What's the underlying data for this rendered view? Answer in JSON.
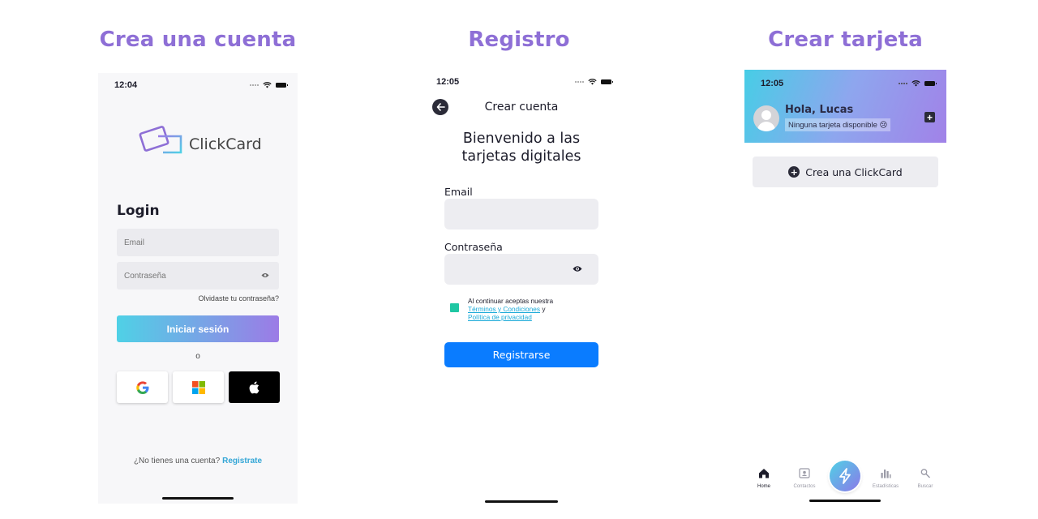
{
  "sections": [
    {
      "title": "Crea una cuenta"
    },
    {
      "title": "Registro"
    },
    {
      "title": "Crear tarjeta"
    }
  ],
  "login_screen": {
    "status_time": "12:04",
    "logo_text": "ClickCard",
    "heading": "Login",
    "email_placeholder": "Email",
    "password_placeholder": "Contraseña",
    "forgot_password": "Olvidaste tu contraseña?",
    "login_button": "Iniciar sesión",
    "or_text": "o",
    "social_buttons": [
      "google-icon",
      "microsoft-icon",
      "apple-icon"
    ],
    "no_account_text": "¿No tienes una cuenta?",
    "register_link": "Registrate"
  },
  "register_screen": {
    "status_time": "12:05",
    "nav_title": "Crear cuenta",
    "headline_line1": "Bienvenido a las",
    "headline_line2": "tarjetas digitales",
    "email_label": "Email",
    "password_label": "Contraseña",
    "terms_prefix": "Al continuar aceptas nuestra",
    "terms_link": "Términos y Condiciones",
    "terms_and": "y",
    "privacy_link": "Política de privacidad",
    "register_button": "Registrarse"
  },
  "home_screen": {
    "status_time": "12:05",
    "greeting": "Hola, Lucas",
    "no_cards_text": "Ninguna tarjeta disponible 😢",
    "create_button": "Crea una ClickCard",
    "tabs": [
      {
        "label": "Home",
        "icon": "home-icon"
      },
      {
        "label": "Contactos",
        "icon": "contacts-icon"
      },
      {
        "label": "",
        "icon": "lightning-icon"
      },
      {
        "label": "Estadísticas",
        "icon": "stats-icon"
      },
      {
        "label": "Buscar",
        "icon": "search-icon"
      }
    ]
  },
  "colors": {
    "section_title": "#8e6fd6",
    "gradient_start": "#4fd1e6",
    "gradient_end": "#9c7be6",
    "primary_blue": "#0a7cff",
    "checkbox": "#1fc7a3",
    "link": "#33a6d6"
  }
}
